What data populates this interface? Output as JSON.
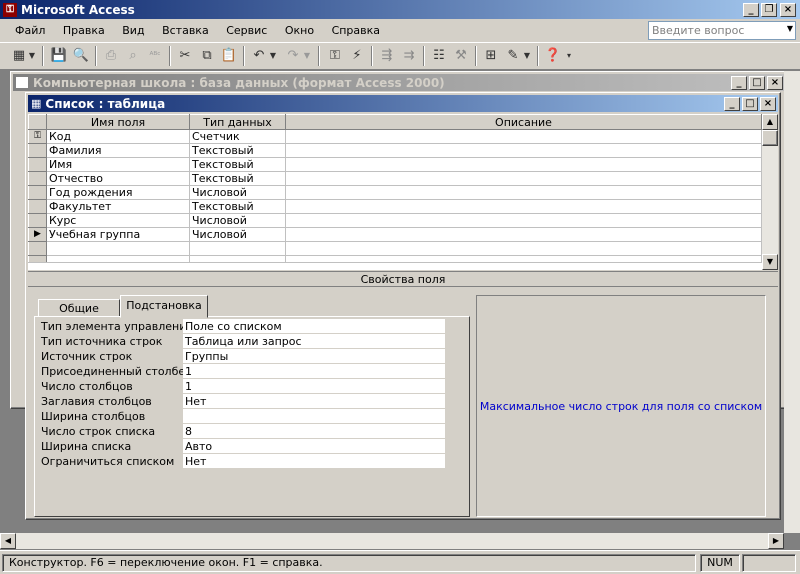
{
  "app": {
    "title": "Microsoft Access",
    "ask_placeholder": "Введите вопрос"
  },
  "menu": [
    "Файл",
    "Правка",
    "Вид",
    "Вставка",
    "Сервис",
    "Окно",
    "Справка"
  ],
  "toolbar_icons": [
    "view-icon",
    "save-icon",
    "search-icon",
    "print-icon",
    "preview-icon",
    "spell-icon",
    "cut-icon",
    "copy-icon",
    "paste-icon",
    "undo-icon",
    "redo-icon",
    "primary-key-icon",
    "builder-icon",
    "insert-rows-icon",
    "delete-rows-icon",
    "properties-icon",
    "build-icon",
    "database-window-icon",
    "new-object-icon",
    "help-icon"
  ],
  "db_window": {
    "title": "Компьютерная школа : база данных (формат Access 2000)"
  },
  "table_window": {
    "title": "Список : таблица",
    "columns": [
      "Имя поля",
      "Тип данных",
      "Описание"
    ],
    "rows": [
      {
        "name": "Код",
        "type": "Счетчик",
        "desc": "",
        "marker": "key"
      },
      {
        "name": "Фамилия",
        "type": "Текстовый",
        "desc": "",
        "marker": ""
      },
      {
        "name": "Имя",
        "type": "Текстовый",
        "desc": "",
        "marker": ""
      },
      {
        "name": "Отчество",
        "type": "Текстовый",
        "desc": "",
        "marker": ""
      },
      {
        "name": "Год рождения",
        "type": "Числовой",
        "desc": "",
        "marker": ""
      },
      {
        "name": "Факультет",
        "type": "Текстовый",
        "desc": "",
        "marker": ""
      },
      {
        "name": "Курс",
        "type": "Числовой",
        "desc": "",
        "marker": ""
      },
      {
        "name": "Учебная группа",
        "type": "Числовой",
        "desc": "",
        "marker": "current"
      },
      {
        "name": "",
        "type": "",
        "desc": "",
        "marker": ""
      },
      {
        "name": "",
        "type": "",
        "desc": "",
        "marker": ""
      }
    ],
    "properties_header": "Свойства поля",
    "tabs": [
      {
        "label": "Общие",
        "active": false
      },
      {
        "label": "Подстановка",
        "active": true
      }
    ],
    "properties": [
      {
        "label": "Тип элемента управления",
        "value": "Поле со списком"
      },
      {
        "label": "Тип источника строк",
        "value": "Таблица или запрос"
      },
      {
        "label": "Источник строк",
        "value": "Группы"
      },
      {
        "label": "Присоединенный столбец",
        "value": "1"
      },
      {
        "label": "Число столбцов",
        "value": "1"
      },
      {
        "label": "Заглавия столбцов",
        "value": "Нет"
      },
      {
        "label": "Ширина столбцов",
        "value": ""
      },
      {
        "label": "Число строк списка",
        "value": "8"
      },
      {
        "label": "Ширина списка",
        "value": "Авто"
      },
      {
        "label": "Ограничиться списком",
        "value": "Нет"
      }
    ],
    "help_text": "Максимальное число строк для поля со списком"
  },
  "statusbar": {
    "text": "Конструктор.  F6 = переключение окон.  F1 = справка.",
    "num": "NUM"
  },
  "colors": {
    "title_active": "#0a246a",
    "face": "#d4d0c8",
    "help_text": "#0000cc"
  }
}
